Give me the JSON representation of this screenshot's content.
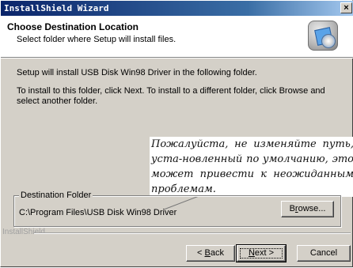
{
  "window": {
    "title": "InstallShield Wizard",
    "close_glyph": "×"
  },
  "header": {
    "title": "Choose Destination Location",
    "subtitle": "Select folder where Setup will install files.",
    "icon": "installer-disk-icon"
  },
  "body": {
    "line1": "Setup will install USB Disk Win98 Driver in the following folder.",
    "line2": "To install to this folder, click Next. To install to a different folder, click Browse and select another folder."
  },
  "annotation": {
    "text": "Пожалуйста, не изменяйте путь, уста-новленный по умолчанию, это может привести к неожиданным проблемам."
  },
  "destination": {
    "legend": "Destination Folder",
    "path": "C:\\Program Files\\USB Disk Win98 Driver",
    "browse_pre": "B",
    "browse_u": "r",
    "browse_post": "owse..."
  },
  "footer": {
    "brand": "InstallShield",
    "back_pre": "< ",
    "back_u": "B",
    "back_post": "ack",
    "next_u": "N",
    "next_post": "ext >",
    "cancel": "Cancel"
  }
}
